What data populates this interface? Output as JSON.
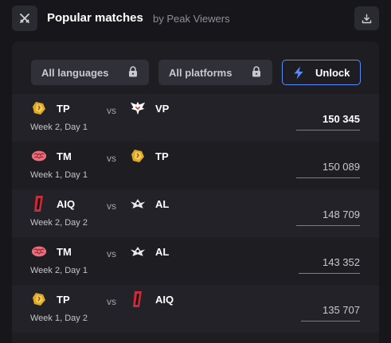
{
  "header": {
    "title": "Popular matches",
    "subtitle": "by Peak Viewers",
    "left_icon": "crossed-swords-icon",
    "right_icon": "download-icon"
  },
  "filters": {
    "languages": "All languages",
    "platforms": "All platforms",
    "unlock": "Unlock"
  },
  "colors": {
    "accent_bar": "#e0506a",
    "unlock_border": "#5a8cff",
    "panel": "#1d1d22"
  },
  "matches": [
    {
      "team1": "TP",
      "team1_logo": "tp-logo",
      "vs": "vs",
      "team2": "VP",
      "team2_logo": "vp-logo",
      "date": "Week 2, Day 1",
      "viewers": "150 345",
      "share": 1.0
    },
    {
      "team1": "TM",
      "team1_logo": "tm-logo",
      "vs": "vs",
      "team2": "TP",
      "team2_logo": "tp-logo",
      "date": "Week 1, Day 1",
      "viewers": "150 089",
      "share": 1.0
    },
    {
      "team1": "AIQ",
      "team1_logo": "aiq-logo",
      "vs": "vs",
      "team2": "AL",
      "team2_logo": "al-logo",
      "date": "Week 2, Day 2",
      "viewers": "148 709",
      "share": 1.0
    },
    {
      "team1": "TM",
      "team1_logo": "tm-logo",
      "vs": "vs",
      "team2": "AL",
      "team2_logo": "al-logo",
      "date": "Week 2, Day 1",
      "viewers": "143 352",
      "share": 0.96
    },
    {
      "team1": "TP",
      "team1_logo": "tp-logo",
      "vs": "vs",
      "team2": "AIQ",
      "team2_logo": "aiq-logo",
      "date": "Week 1, Day 2",
      "viewers": "135 707",
      "share": 0.92
    }
  ]
}
